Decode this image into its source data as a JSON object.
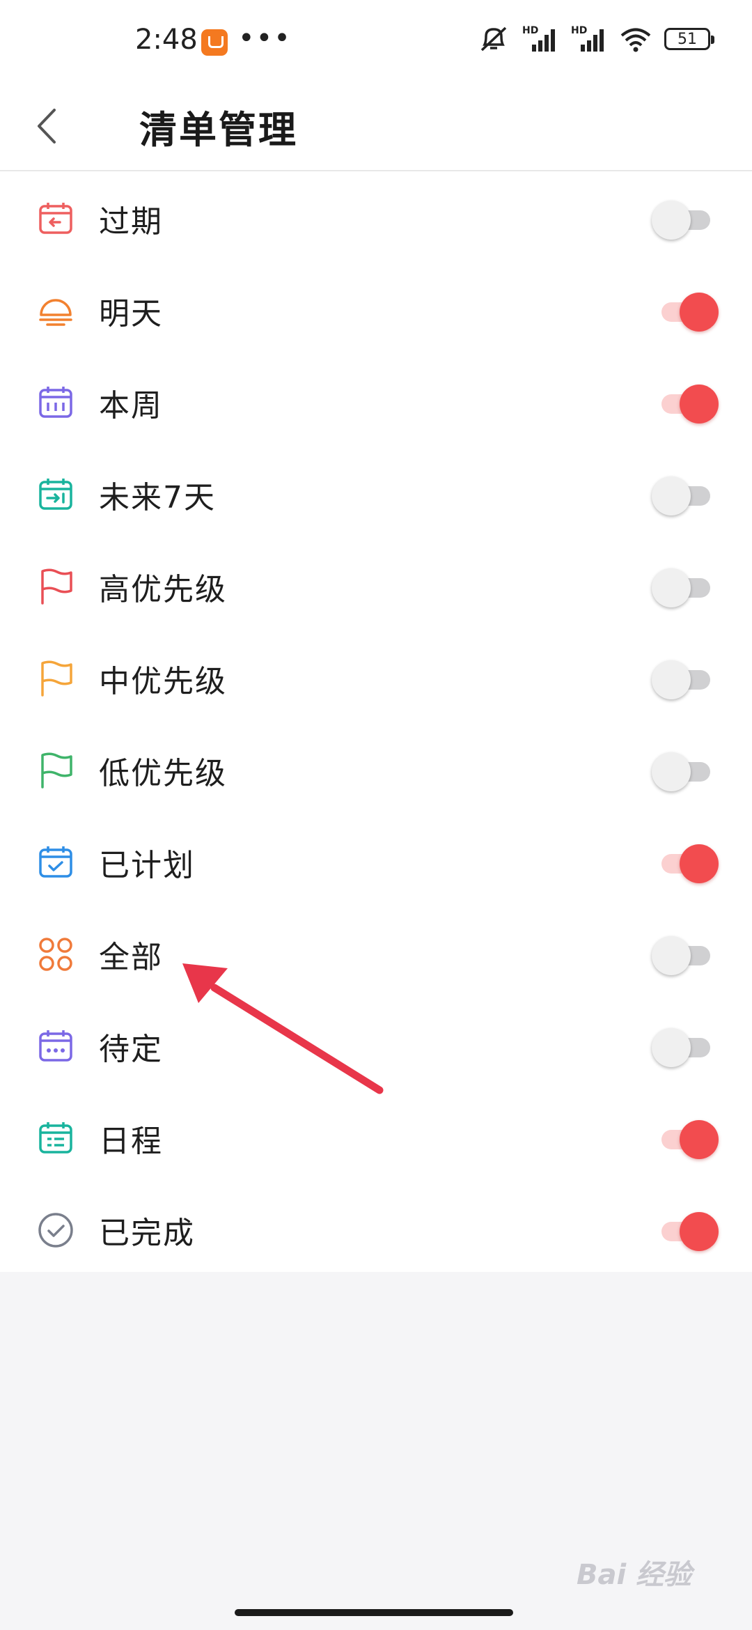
{
  "status_bar": {
    "time": "2:48",
    "more": "•••",
    "battery": "51",
    "hd1": "HD",
    "hd2": "HD"
  },
  "header": {
    "title": "清单管理",
    "back_icon": "chevron-left-icon"
  },
  "list": {
    "items": [
      {
        "label": "过期",
        "icon": "calendar-overdue-icon",
        "icon_color": "#ee5f5f",
        "enabled": false
      },
      {
        "label": "明天",
        "icon": "sunrise-icon",
        "icon_color": "#f2812f",
        "enabled": true
      },
      {
        "label": "本周",
        "icon": "calendar-week-icon",
        "icon_color": "#7b68e6",
        "enabled": true
      },
      {
        "label": "未来7天",
        "icon": "calendar-next-icon",
        "icon_color": "#19b49d",
        "enabled": false
      },
      {
        "label": "高优先级",
        "icon": "flag-high-icon",
        "icon_color": "#e94f55",
        "enabled": false
      },
      {
        "label": "中优先级",
        "icon": "flag-medium-icon",
        "icon_color": "#f5a53a",
        "enabled": false
      },
      {
        "label": "低优先级",
        "icon": "flag-low-icon",
        "icon_color": "#3fb46a",
        "enabled": false
      },
      {
        "label": "已计划",
        "icon": "calendar-check-icon",
        "icon_color": "#2e8ee6",
        "enabled": true
      },
      {
        "label": "全部",
        "icon": "grid-circles-icon",
        "icon_color": "#f07a3a",
        "enabled": false
      },
      {
        "label": "待定",
        "icon": "calendar-pending-icon",
        "icon_color": "#7b68e6",
        "enabled": false
      },
      {
        "label": "日程",
        "icon": "calendar-agenda-icon",
        "icon_color": "#19b49d",
        "enabled": true
      },
      {
        "label": "已完成",
        "icon": "check-circle-icon",
        "icon_color": "#7a7f8c",
        "enabled": true
      }
    ]
  },
  "colors": {
    "accent": "#f24c4f",
    "toggle_off": "#d0d0d2",
    "annotation_arrow": "#e8364a"
  },
  "watermark": "Bai 经验"
}
